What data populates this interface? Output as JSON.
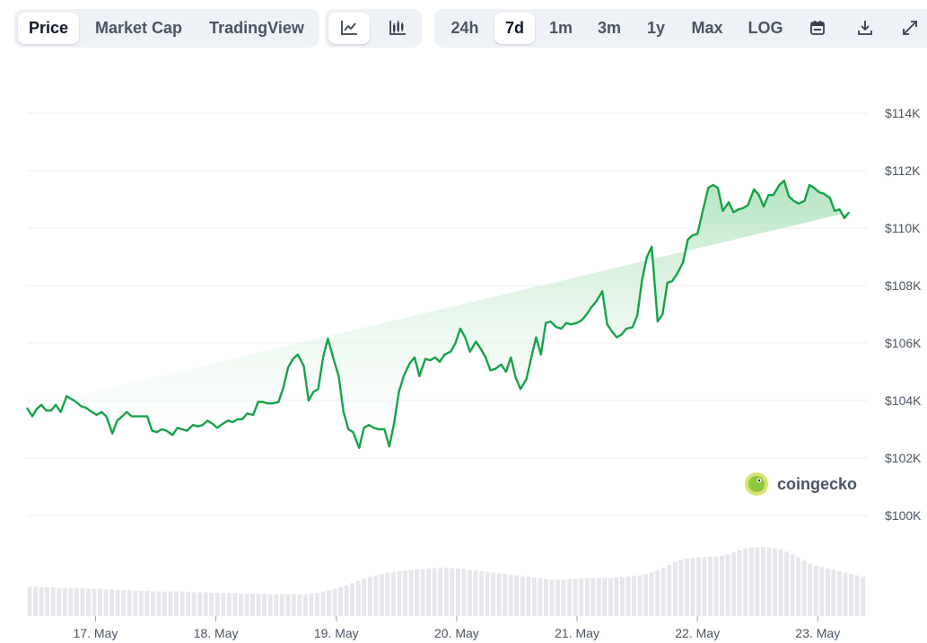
{
  "toolbar": {
    "metric_tabs": [
      "Price",
      "Market Cap",
      "TradingView"
    ],
    "active_metric": "Price",
    "chart_style_icons": [
      "line-chart-icon",
      "candlestick-chart-icon"
    ],
    "active_style": "line-chart-icon",
    "ranges": [
      "24h",
      "7d",
      "1m",
      "3m",
      "1y",
      "Max",
      "LOG"
    ],
    "active_range": "7d",
    "action_icons": [
      "calendar-icon",
      "download-icon",
      "expand-icon"
    ]
  },
  "watermark": {
    "text": "coingecko"
  },
  "colors": {
    "line": "#16a34a",
    "area_top": "#bfe8c9",
    "volume_bar": "#e5e7eb",
    "grid": "#eceff3"
  },
  "chart_data": {
    "type": "area",
    "y_axis_side": "right",
    "ylim": [
      100000,
      114000
    ],
    "y_ticks": [
      100000,
      102000,
      104000,
      106000,
      108000,
      110000,
      112000,
      114000
    ],
    "y_tick_labels": [
      "$100K",
      "$102K",
      "$104K",
      "$106K",
      "$108K",
      "$110K",
      "$112K",
      "$114K"
    ],
    "x_labels": [
      "17. May",
      "18. May",
      "19. May",
      "20. May",
      "21. May",
      "22. May",
      "23. May"
    ],
    "x_label_positions_day": [
      1,
      2,
      3,
      4,
      5,
      6,
      7
    ],
    "xlim_day": [
      0.43,
      7.4
    ],
    "grid": true,
    "series": [
      {
        "x_day": [
          0.43,
          0.475,
          0.51,
          0.55,
          0.59,
          0.63,
          0.67,
          0.71,
          0.76,
          0.8,
          0.84,
          0.88,
          0.92,
          0.97,
          1.01,
          1.05,
          1.09,
          1.14,
          1.18,
          1.22,
          1.26,
          1.3,
          1.35,
          1.39,
          1.43,
          1.47,
          1.51,
          1.55,
          1.59,
          1.64,
          1.68,
          1.72,
          1.76,
          1.81,
          1.85,
          1.89,
          1.93,
          1.97,
          2.01,
          2.06,
          2.1,
          2.14,
          2.18,
          2.22,
          2.26,
          2.31,
          2.35,
          2.39,
          2.43,
          2.47,
          2.52,
          2.56,
          2.6,
          2.64,
          2.68,
          2.73,
          2.77,
          2.81,
          2.85,
          2.89,
          2.93,
          2.98,
          3.02,
          3.06,
          3.1,
          3.14,
          3.19,
          3.23,
          3.27,
          3.31,
          3.35,
          3.4,
          3.44,
          3.48,
          3.52,
          3.56,
          3.61,
          3.65,
          3.69,
          3.74,
          3.78,
          3.82,
          3.86,
          3.9,
          3.95,
          3.99,
          4.03,
          4.07,
          4.11,
          4.16,
          4.2,
          4.24,
          4.28,
          4.32,
          4.37,
          4.41,
          4.45,
          4.49,
          4.53,
          4.58,
          4.62,
          4.66,
          4.7,
          4.74,
          4.78,
          4.83,
          4.87,
          4.91,
          4.95,
          5,
          5.04,
          5.08,
          5.12,
          5.16,
          5.21,
          5.25,
          5.29,
          5.33,
          5.37,
          5.41,
          5.46,
          5.5,
          5.54,
          5.58,
          5.62,
          5.67,
          5.71,
          5.75,
          5.79,
          5.83,
          5.88,
          5.92,
          5.96,
          6,
          6.05,
          6.09,
          6.13,
          6.17,
          6.21,
          6.26,
          6.3,
          6.34,
          6.38,
          6.42,
          6.47,
          6.51,
          6.55,
          6.59,
          6.63,
          6.68,
          6.72,
          6.76,
          6.8,
          6.84,
          6.89,
          6.93,
          6.97,
          7.01,
          7.05,
          7.1,
          7.14,
          7.18,
          7.22,
          7.26,
          7.31,
          7.35,
          7.38
        ],
        "values": [
          103750,
          103450,
          103700,
          103850,
          103650,
          103650,
          103850,
          103600,
          104150,
          104050,
          103950,
          103800,
          103750,
          103600,
          103500,
          103600,
          103450,
          102850,
          103300,
          103450,
          103600,
          103450,
          103450,
          103450,
          103450,
          102950,
          102900,
          103000,
          102950,
          102800,
          103050,
          103000,
          102950,
          103150,
          103100,
          103150,
          103300,
          103200,
          103050,
          103200,
          103300,
          103250,
          103350,
          103350,
          103550,
          103500,
          103950,
          103950,
          103900,
          103900,
          103950,
          104450,
          105150,
          105450,
          105600,
          105200,
          104000,
          104300,
          104400,
          105500,
          106150,
          105400,
          104850,
          103600,
          103000,
          102900,
          102350,
          103050,
          103150,
          103050,
          103000,
          103000,
          102400,
          103200,
          104300,
          104850,
          105300,
          105500,
          104850,
          105450,
          105400,
          105500,
          105350,
          105600,
          105700,
          106000,
          106500,
          106200,
          105700,
          106050,
          105800,
          105500,
          105050,
          105100,
          105250,
          105000,
          105500,
          104800,
          104400,
          104750,
          105500,
          106200,
          105600,
          106700,
          106750,
          106550,
          106500,
          106700,
          106650,
          106700,
          106800,
          107000,
          107250,
          107450,
          107800,
          106650,
          106400,
          106200,
          106300,
          106500,
          106550,
          106950,
          108200,
          109000,
          109350,
          106750,
          107000,
          108100,
          108150,
          108400,
          108800,
          109600,
          109750,
          109800,
          110700,
          111400,
          111500,
          111400,
          110600,
          110900,
          110550,
          110650,
          110700,
          110800,
          111350,
          111150,
          110750,
          111150,
          111150,
          111500,
          111650,
          111100,
          110950,
          110850,
          110950,
          111500,
          111400,
          111250,
          111200,
          111050,
          110600,
          110650,
          110350,
          110550
        ]
      }
    ],
    "volume": {
      "note": "relative trading volume, bottom strip (no axis)",
      "values": [
        0.42,
        0.42,
        0.41,
        0.41,
        0.41,
        0.4,
        0.4,
        0.4,
        0.4,
        0.4,
        0.39,
        0.39,
        0.39,
        0.38,
        0.38,
        0.37,
        0.37,
        0.37,
        0.36,
        0.36,
        0.36,
        0.35,
        0.35,
        0.35,
        0.35,
        0.35,
        0.35,
        0.34,
        0.34,
        0.34,
        0.34,
        0.33,
        0.33,
        0.33,
        0.33,
        0.33,
        0.32,
        0.32,
        0.32,
        0.32,
        0.32,
        0.31,
        0.31,
        0.31,
        0.31,
        0.31,
        0.31,
        0.31,
        0.32,
        0.33,
        0.35,
        0.37,
        0.39,
        0.41,
        0.44,
        0.47,
        0.5,
        0.53,
        0.56,
        0.58,
        0.6,
        0.62,
        0.63,
        0.64,
        0.65,
        0.66,
        0.67,
        0.67,
        0.68,
        0.68,
        0.69,
        0.69,
        0.68,
        0.68,
        0.67,
        0.66,
        0.65,
        0.64,
        0.63,
        0.62,
        0.61,
        0.6,
        0.59,
        0.58,
        0.57,
        0.56,
        0.55,
        0.54,
        0.53,
        0.52,
        0.52,
        0.52,
        0.53,
        0.53,
        0.54,
        0.54,
        0.54,
        0.54,
        0.54,
        0.54,
        0.55,
        0.55,
        0.56,
        0.57,
        0.58,
        0.6,
        0.62,
        0.65,
        0.69,
        0.73,
        0.77,
        0.8,
        0.82,
        0.83,
        0.84,
        0.84,
        0.85,
        0.85,
        0.86,
        0.88,
        0.91,
        0.94,
        0.97,
        0.98,
        0.98,
        0.99,
        0.98,
        0.97,
        0.95,
        0.92,
        0.88,
        0.84,
        0.79,
        0.75,
        0.72,
        0.7,
        0.68,
        0.66,
        0.64,
        0.62,
        0.6,
        0.58,
        0.56
      ]
    }
  }
}
